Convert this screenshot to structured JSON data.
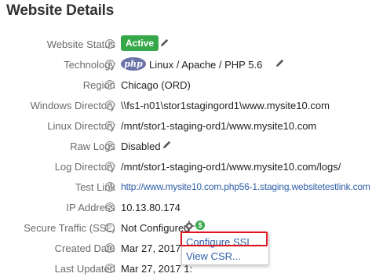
{
  "header": {
    "title": "Website Details"
  },
  "rows": [
    {
      "label": "Website Status",
      "value": "Active"
    },
    {
      "label": "Technology",
      "logo_text": "php",
      "value": "Linux / Apache / PHP 5.6"
    },
    {
      "label": "Region",
      "value": "Chicago (ORD)"
    },
    {
      "label": "Windows Directory",
      "value": "\\\\fs1-n01\\stor1stagingord1\\www.mysite10.com"
    },
    {
      "label": "Linux Directory",
      "value": "/mnt/stor1-staging-ord1/www.mysite10.com"
    },
    {
      "label": "Raw Logs",
      "value": "Disabled"
    },
    {
      "label": "Log Directory",
      "value": "/mnt/stor1-staging-ord1/www.mysite10.com/logs/"
    },
    {
      "label": "Test Link",
      "value": "http://www.mysite10.com.php56-1.staging.websitetestlink.com"
    },
    {
      "label": "IP Address",
      "value": "10.13.80.174"
    },
    {
      "label": "Secure Traffic (SSL)",
      "value": "Not Configured"
    },
    {
      "label": "Created Date",
      "value": "Mar 27, 2017 1:"
    },
    {
      "label": "Last Updated",
      "value": "Mar 27, 2017 1:"
    }
  ],
  "help_glyph": "?",
  "dollar_glyph": "$",
  "ssl_menu": {
    "items": [
      "Configure SSL...",
      "View CSR..."
    ]
  },
  "colors": {
    "active_badge": "#37a84a",
    "link": "#2f5fa8",
    "highlight": "#e0151e"
  }
}
